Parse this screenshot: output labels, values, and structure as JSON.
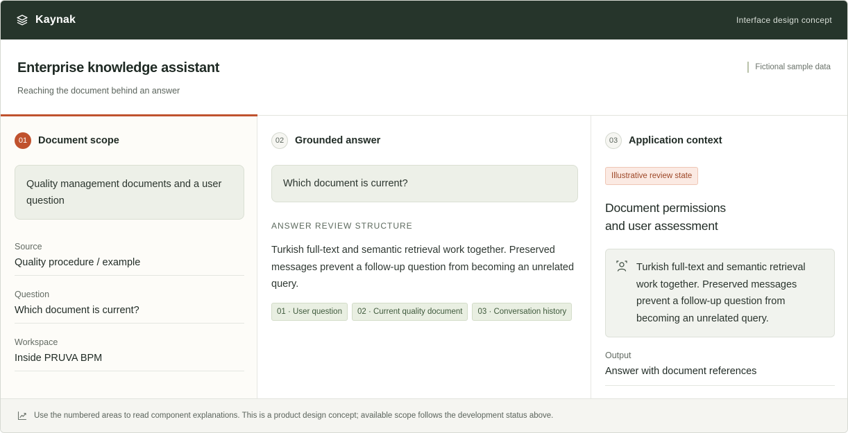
{
  "app": {
    "name": "Kaynak",
    "concept_label": "Interface design concept"
  },
  "header": {
    "title": "Enterprise knowledge assistant",
    "subtitle": "Reaching the document behind an answer",
    "sample_note": "Fictional sample data"
  },
  "steps": [
    {
      "number": "01",
      "title": "Document scope",
      "bubble": "Quality management documents and a user question",
      "fields": [
        {
          "label": "Source",
          "value": "Quality procedure / example"
        },
        {
          "label": "Question",
          "value": "Which document is current?"
        },
        {
          "label": "Workspace",
          "value": "Inside PRUVA BPM"
        }
      ]
    },
    {
      "number": "02",
      "title": "Grounded answer",
      "bubble": "Which document is current?",
      "caption": "ANSWER REVIEW STRUCTURE",
      "answer": "Turkish full-text and semantic retrieval work together. Preserved messages prevent a follow-up question from becoming an unrelated query.",
      "chips": [
        "01 · User question",
        "02 · Current quality document",
        "03 · Conversation history"
      ]
    },
    {
      "number": "03",
      "title": "Application context",
      "badge": "Illustrative review state",
      "context_title_line1": "Document permissions",
      "context_title_line2": "and user assessment",
      "context_text": "Turkish full-text and semantic retrieval work together. Preserved messages prevent a follow-up question from becoming an unrelated query.",
      "output_label": "Output",
      "output_value": "Answer with document references"
    }
  ],
  "footer": {
    "icon": "chart-line-icon",
    "text": "Use the numbered areas to read component explanations. This is a product design concept; available scope follows the development status above."
  },
  "colors": {
    "topbar": "#26352b",
    "accent": "#c0522e",
    "chip_bg": "#e9efe2",
    "badge_bg": "#fbeae3"
  }
}
